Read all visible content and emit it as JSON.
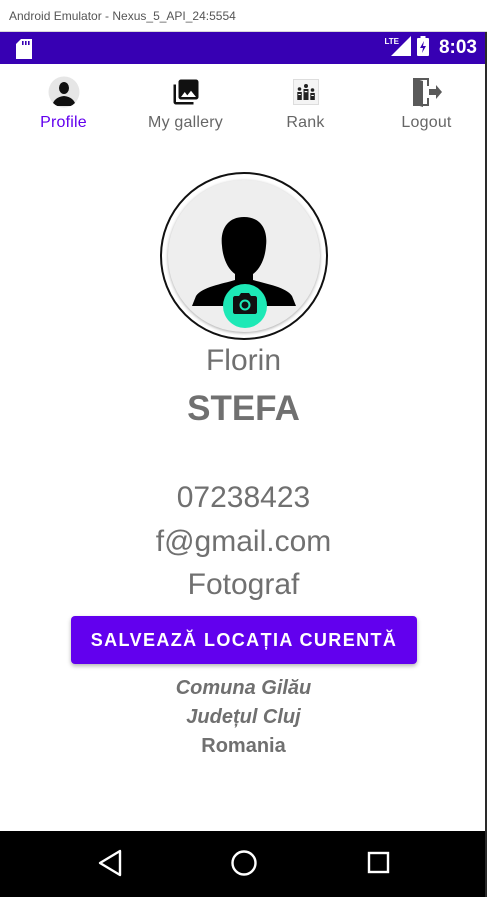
{
  "window": {
    "title": "Android Emulator - Nexus_5_API_24:5554"
  },
  "status_bar": {
    "network": "LTE",
    "time": "8:03"
  },
  "nav": {
    "items": [
      {
        "label": "Profile",
        "icon": "profile-avatar-icon",
        "active": true
      },
      {
        "label": "My gallery",
        "icon": "gallery-icon",
        "active": false
      },
      {
        "label": "Rank",
        "icon": "rank-icon",
        "active": false
      },
      {
        "label": "Logout",
        "icon": "logout-icon",
        "active": false
      }
    ]
  },
  "profile": {
    "first_name": "Florin",
    "last_name": "STEFA",
    "phone": "07238423",
    "email": "f@gmail.com",
    "occupation": "Fotograf"
  },
  "actions": {
    "save_location_label": "SALVEAZĂ LOCAȚIA CURENTĂ"
  },
  "location": {
    "commune": "Comuna Gilău",
    "county": "Județul Cluj",
    "country": "Romania"
  },
  "colors": {
    "primary": "#6200ee",
    "status_bar": "#3700b3",
    "fab": "#1de9b6",
    "text": "#707070"
  }
}
